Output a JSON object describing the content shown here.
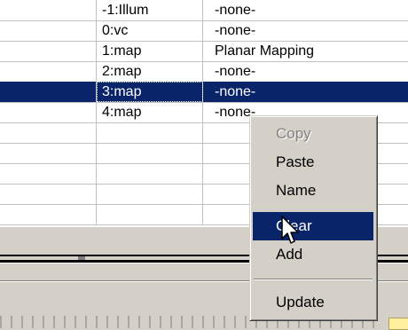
{
  "rows": [
    {
      "channel": "-1:Illum",
      "mapping": "-none-"
    },
    {
      "channel": "0:vc",
      "mapping": "-none-"
    },
    {
      "channel": "1:map",
      "mapping": "Planar Mapping"
    },
    {
      "channel": "2:map",
      "mapping": "-none-"
    },
    {
      "channel": "3:map",
      "mapping": "-none-",
      "selected": true
    },
    {
      "channel": "4:map",
      "mapping": "-none-"
    },
    {
      "channel": "",
      "mapping": ""
    },
    {
      "channel": "",
      "mapping": ""
    },
    {
      "channel": "",
      "mapping": ""
    },
    {
      "channel": "",
      "mapping": ""
    },
    {
      "channel": "",
      "mapping": ""
    }
  ],
  "context_menu": {
    "items": [
      {
        "label": "Copy",
        "state": "disabled"
      },
      {
        "label": "Paste",
        "state": "normal"
      },
      {
        "label": "Name",
        "state": "normal"
      },
      {
        "label": "Clear",
        "state": "highlighted"
      },
      {
        "label": "Add",
        "state": "normal"
      },
      {
        "label": "Update",
        "state": "normal"
      }
    ]
  },
  "colors": {
    "selection": "#0a246a",
    "face": "#d4d0c8"
  },
  "icons": {
    "pointer": "arrow-cursor-icon"
  }
}
